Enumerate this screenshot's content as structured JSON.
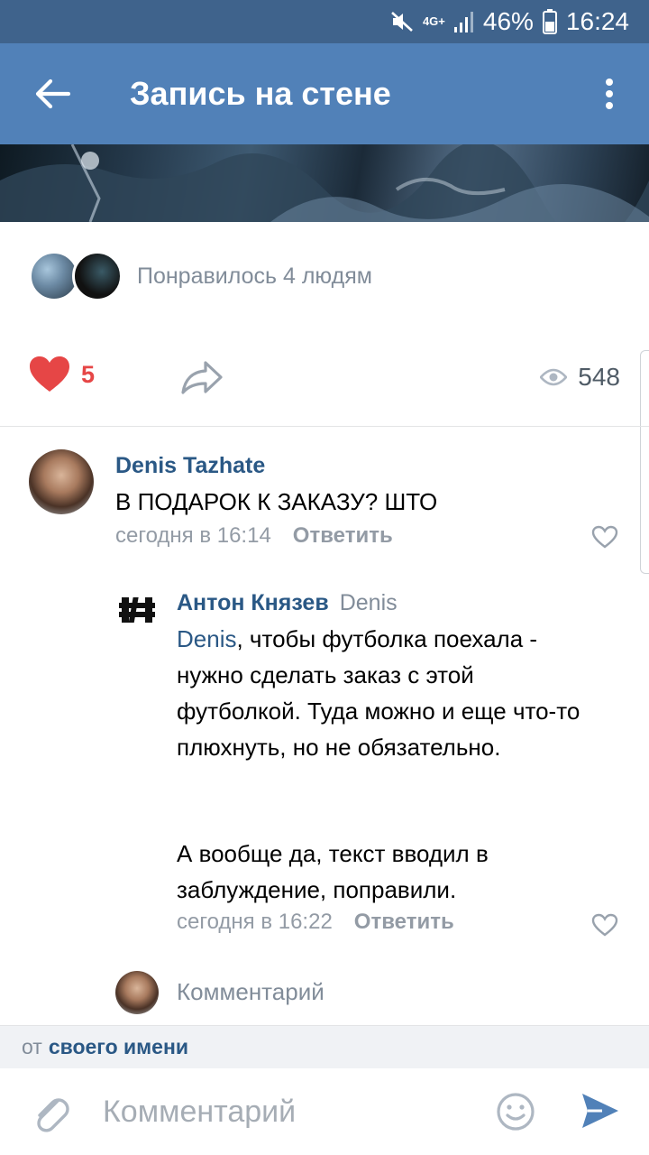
{
  "status_bar": {
    "network": "4G+",
    "battery": "46%",
    "time": "16:24"
  },
  "header": {
    "title": "Запись на стене"
  },
  "likes": {
    "text": "Понравилось 4 людям"
  },
  "actions": {
    "like_count": "5",
    "views": "548"
  },
  "comments": [
    {
      "author": "Denis Tazhate",
      "text": "В ПОДАРОК К ЗАКАЗУ? ШТО",
      "time": "сегодня в 16:14",
      "reply_label": "Ответить"
    },
    {
      "author": "Антон Князев",
      "reply_to": "Denis",
      "mention": "Denis",
      "text_after_mention": ", чтобы футболка поехала - нужно сделать заказ с этой футболкой. Туда можно и еще что-то плюхнуть, но не обязательно.",
      "text_2": "А вообще да, текст вводил в заблуждение, поправили.",
      "time": "сегодня в 16:22",
      "reply_label": "Ответить"
    }
  ],
  "inline_comment": {
    "placeholder": "Комментарий"
  },
  "post_as": {
    "prefix": "от",
    "name": "своего имени"
  },
  "composer": {
    "placeholder": "Комментарий"
  },
  "colors": {
    "header": "#5181b8",
    "status_bar": "#3f638c",
    "accent": "#2a5885",
    "like": "#e64646"
  },
  "icons": [
    "back-arrow-icon",
    "more-vertical-icon",
    "heart-icon",
    "share-icon",
    "eye-icon",
    "attach-icon",
    "smile-icon",
    "send-icon"
  ]
}
